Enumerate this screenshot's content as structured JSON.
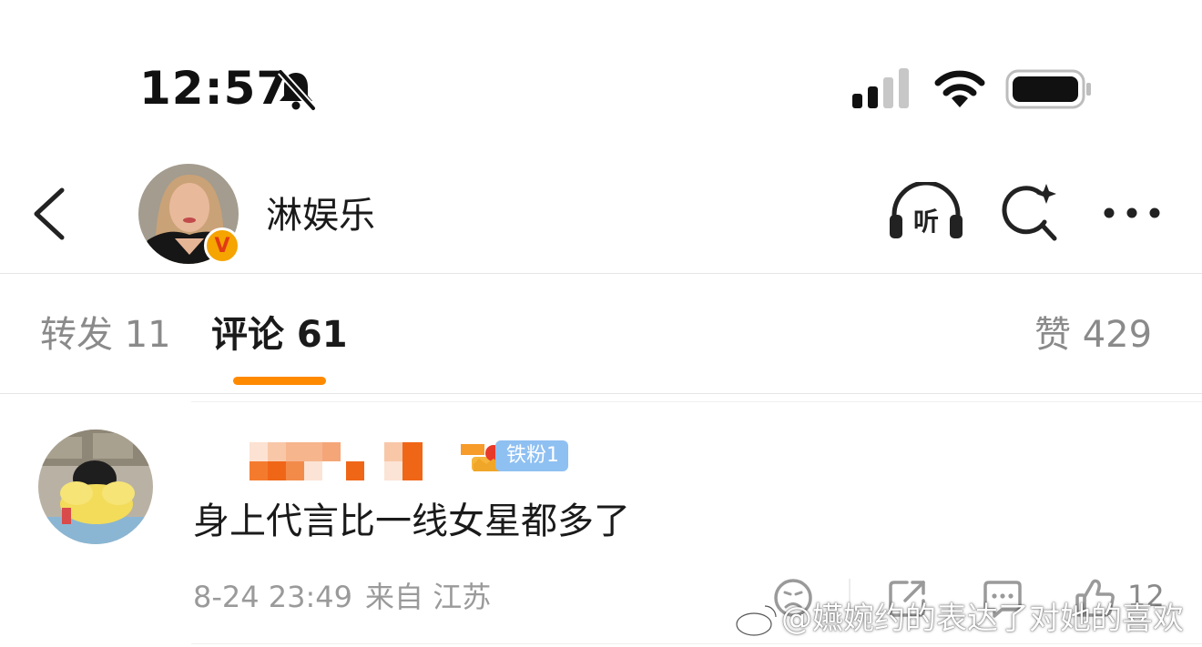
{
  "status_bar": {
    "time": "12:57",
    "silent_icon": "bell-slash-icon",
    "signal_icon": "cellular-signal-icon",
    "wifi_icon": "wifi-icon",
    "battery_icon": "battery-icon"
  },
  "header": {
    "back_icon": "chevron-left-icon",
    "account_name": "淋娱乐",
    "verified_badge": "V",
    "listen_label": "听",
    "search_icon": "ai-search-icon",
    "more_icon": "more-horizontal-icon"
  },
  "tabs": {
    "repost": "转发 11",
    "comment": "评论 61",
    "like": "赞 429",
    "active_color": "#ff8a00"
  },
  "comment": {
    "fan_badge": "铁粉1",
    "text": "身上代言比一线女星都多了",
    "date": "8-24 23:49",
    "location": "来自 江苏",
    "like_count": "12",
    "icons": [
      "frown-face-icon",
      "share-arrow-icon",
      "comment-bubble-icon",
      "thumbs-up-icon"
    ]
  },
  "watermark": "@嬿婉约的表达了对她的喜欢"
}
